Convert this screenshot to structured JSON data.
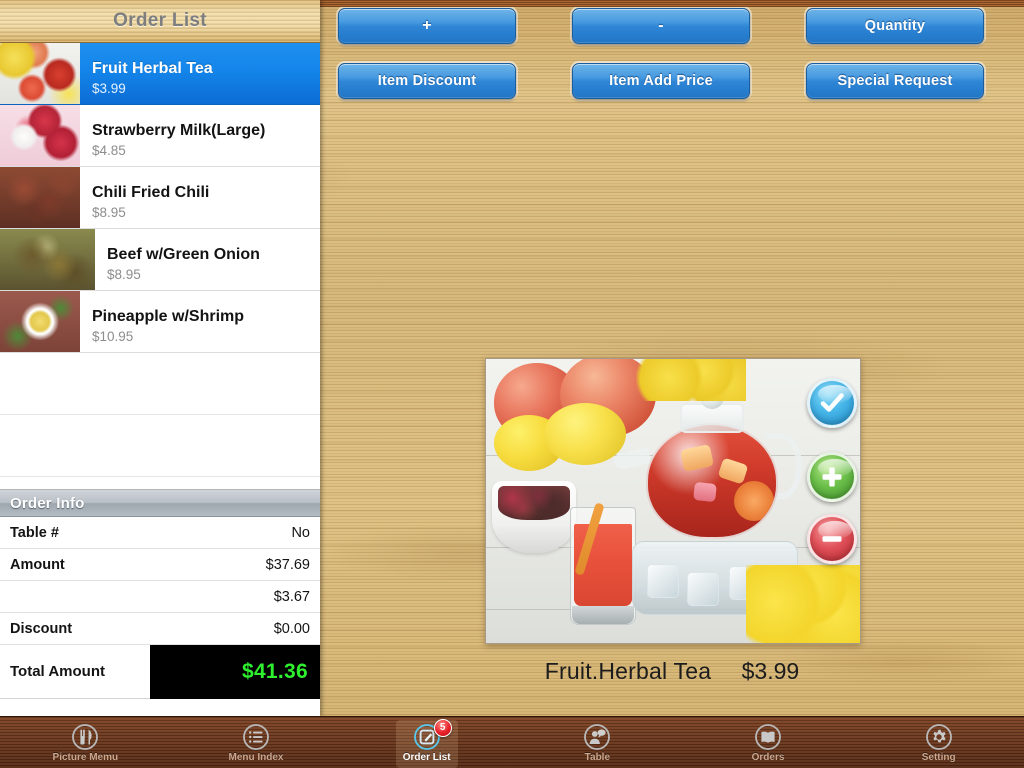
{
  "sidebar": {
    "header_title": "Order List",
    "items": [
      {
        "name": "Fruit Herbal Tea",
        "price": "$3.99",
        "thumb": "fruit-herbal-tea",
        "selected": true
      },
      {
        "name": "Strawberry Milk(Large)",
        "price": "$4.85",
        "thumb": "strawberry-milk",
        "selected": false
      },
      {
        "name": "Chili Fried Chili",
        "price": "$8.95",
        "thumb": "chili-fried-chili",
        "selected": false
      },
      {
        "name": "Beef w/Green Onion",
        "price": "$8.95",
        "thumb": "beef-green-onion",
        "selected": false
      },
      {
        "name": "Pineapple w/Shrimp",
        "price": "$10.95",
        "thumb": "pineapple-shrimp",
        "selected": false
      }
    ],
    "empty_row_count": 2
  },
  "order_info": {
    "header_title": "Order Info",
    "rows": [
      {
        "label": "Table #",
        "value": "No"
      },
      {
        "label": "Amount",
        "value": "$37.69"
      },
      {
        "label": "",
        "value": "$3.67"
      },
      {
        "label": "Discount",
        "value": "$0.00"
      }
    ],
    "total_label": "Total Amount",
    "total_value": "$41.36",
    "total_color": "#2ff02f"
  },
  "toolbar": {
    "buttons": [
      {
        "label": "+",
        "name": "increase-button"
      },
      {
        "label": "-",
        "name": "decrease-button"
      },
      {
        "label": "Quantity",
        "name": "quantity-button"
      },
      {
        "label": "Item Discount",
        "name": "item-discount-button"
      },
      {
        "label": "Item Add Price",
        "name": "item-add-price-button"
      },
      {
        "label": "Special Request",
        "name": "special-request-button"
      }
    ],
    "accent_color": "#2f86d6"
  },
  "product": {
    "image_alt": "fruit-herbal-tea-photo",
    "caption_name": "Fruit.Herbal Tea",
    "caption_price": "$3.99",
    "actions": [
      {
        "icon": "check-icon",
        "name": "confirm-button",
        "color": "#46b6e8"
      },
      {
        "icon": "plus-icon",
        "name": "add-quantity-button",
        "color": "#6cc04a"
      },
      {
        "icon": "minus-icon",
        "name": "remove-quantity-button",
        "color": "#e05058"
      }
    ]
  },
  "tabbar": {
    "tabs": [
      {
        "label": "Picture Memu",
        "icon": "utensils-icon",
        "active": false,
        "badge": ""
      },
      {
        "label": "Menu Index",
        "icon": "list-icon",
        "active": false,
        "badge": ""
      },
      {
        "label": "Order List",
        "icon": "compose-icon",
        "active": true,
        "badge": "5"
      },
      {
        "label": "Table",
        "icon": "person-bubble-icon",
        "active": false,
        "badge": ""
      },
      {
        "label": "Orders",
        "icon": "book-icon",
        "active": false,
        "badge": ""
      },
      {
        "label": "Setting",
        "icon": "gear-icon",
        "active": false,
        "badge": ""
      }
    ]
  }
}
